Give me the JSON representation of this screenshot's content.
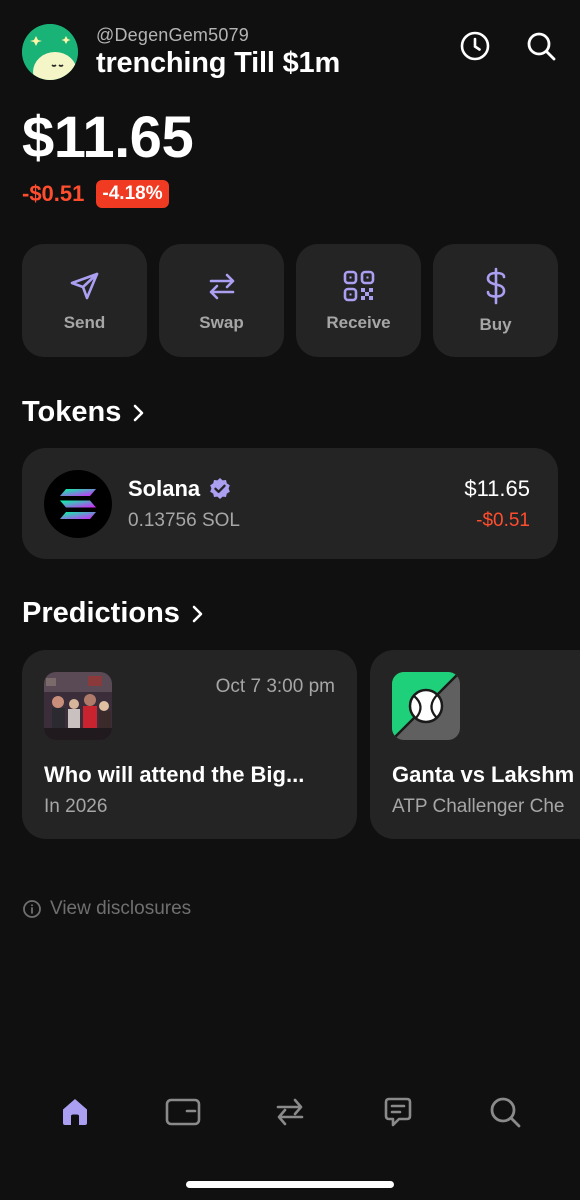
{
  "header": {
    "handle": "@DegenGem5079",
    "account_name": "trenching Till $1m",
    "icons": [
      "avatar",
      "history-icon",
      "search-icon"
    ]
  },
  "portfolio": {
    "balance": "$11.65",
    "change_amount": "-$0.51",
    "change_percent": "-4.18%"
  },
  "actions": [
    {
      "label": "Send",
      "icon": "send-icon"
    },
    {
      "label": "Swap",
      "icon": "swap-icon"
    },
    {
      "label": "Receive",
      "icon": "qr-code-icon"
    },
    {
      "label": "Buy",
      "icon": "dollar-icon"
    }
  ],
  "tokens": {
    "title": "Tokens",
    "items": [
      {
        "name": "Solana",
        "amount": "0.13756 SOL",
        "value": "$11.65",
        "change": "-$0.51",
        "icon": "solana-icon",
        "verified": true
      }
    ]
  },
  "predictions": {
    "title": "Predictions",
    "items": [
      {
        "date": "Oct 7 3:00 pm",
        "title": "Who will attend the Big...",
        "subtitle": "In 2026",
        "icon": "event-photo-thumbnail"
      },
      {
        "date": "",
        "title": "Ganta vs Lakshm",
        "subtitle": "ATP Challenger Che",
        "icon": "tennis-ball-icon"
      }
    ]
  },
  "disclosure": {
    "label": "View disclosures"
  },
  "tabbar": [
    {
      "name": "home",
      "icon": "home-icon",
      "active": true
    },
    {
      "name": "wallet",
      "icon": "wallet-icon",
      "active": false
    },
    {
      "name": "swap",
      "icon": "swap-arrows-icon",
      "active": false
    },
    {
      "name": "messages",
      "icon": "chat-icon",
      "active": false
    },
    {
      "name": "search",
      "icon": "search-icon",
      "active": false
    }
  ],
  "colors": {
    "background": "#101010",
    "card": "#242424",
    "accent": "#ab9ff2",
    "negative": "#ff4d2e",
    "muted_text": "#a6a6a6"
  }
}
